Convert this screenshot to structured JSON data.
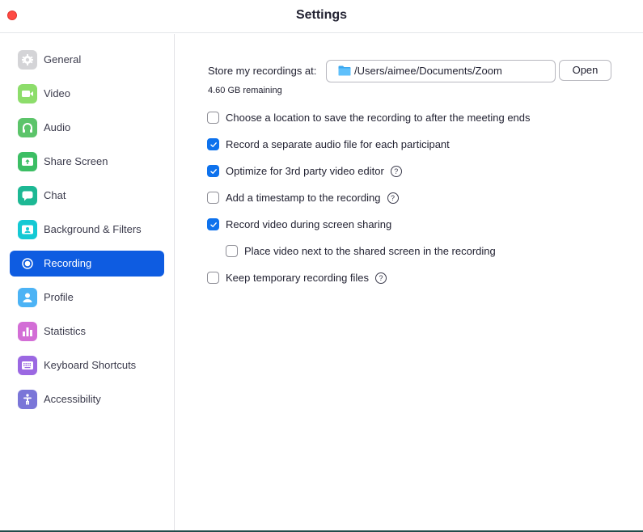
{
  "window": {
    "title": "Settings"
  },
  "sidebar": {
    "items": [
      {
        "label": "General",
        "icon": "gear-icon",
        "color": "#d4d4d7",
        "active": false
      },
      {
        "label": "Video",
        "icon": "video-camera-icon",
        "color": "#8ddd6b",
        "active": false
      },
      {
        "label": "Audio",
        "icon": "headphones-icon",
        "color": "#5cc46a",
        "active": false
      },
      {
        "label": "Share Screen",
        "icon": "share-screen-icon",
        "color": "#3cbe64",
        "active": false
      },
      {
        "label": "Chat",
        "icon": "chat-bubble-icon",
        "color": "#1db894",
        "active": false
      },
      {
        "label": "Background & Filters",
        "icon": "background-person-icon",
        "color": "#14c9d4",
        "active": false
      },
      {
        "label": "Recording",
        "icon": "record-icon",
        "color": "#ffffff",
        "active": true
      },
      {
        "label": "Profile",
        "icon": "profile-icon",
        "color": "#4cb3f5",
        "active": false
      },
      {
        "label": "Statistics",
        "icon": "bar-chart-icon",
        "color": "#d36ed6",
        "active": false
      },
      {
        "label": "Keyboard Shortcuts",
        "icon": "keyboard-icon",
        "color": "#9b68e2",
        "active": false
      },
      {
        "label": "Accessibility",
        "icon": "accessibility-icon",
        "color": "#7a76d8",
        "active": false
      }
    ]
  },
  "recording": {
    "store_label": "Store my recordings at:",
    "path": "/Users/aimee/Documents/Zoom",
    "open_label": "Open",
    "remaining": "4.60 GB remaining",
    "options": [
      {
        "label": "Choose a location to save the recording to after the meeting ends",
        "checked": false,
        "help": false,
        "indent": false
      },
      {
        "label": "Record a separate audio file for each participant",
        "checked": true,
        "help": false,
        "indent": false
      },
      {
        "label": "Optimize for 3rd party video editor",
        "checked": true,
        "help": true,
        "indent": false
      },
      {
        "label": "Add a timestamp to the recording",
        "checked": false,
        "help": true,
        "indent": false
      },
      {
        "label": "Record video during screen sharing",
        "checked": true,
        "help": false,
        "indent": false
      },
      {
        "label": "Place video next to the shared screen in the recording",
        "checked": false,
        "help": false,
        "indent": true
      },
      {
        "label": "Keep temporary recording files",
        "checked": false,
        "help": true,
        "indent": false
      }
    ],
    "help_glyph": "?"
  },
  "colors": {
    "accent": "#0e5ce1",
    "checkbox": "#0e72ed",
    "close": "#fe4a43"
  }
}
